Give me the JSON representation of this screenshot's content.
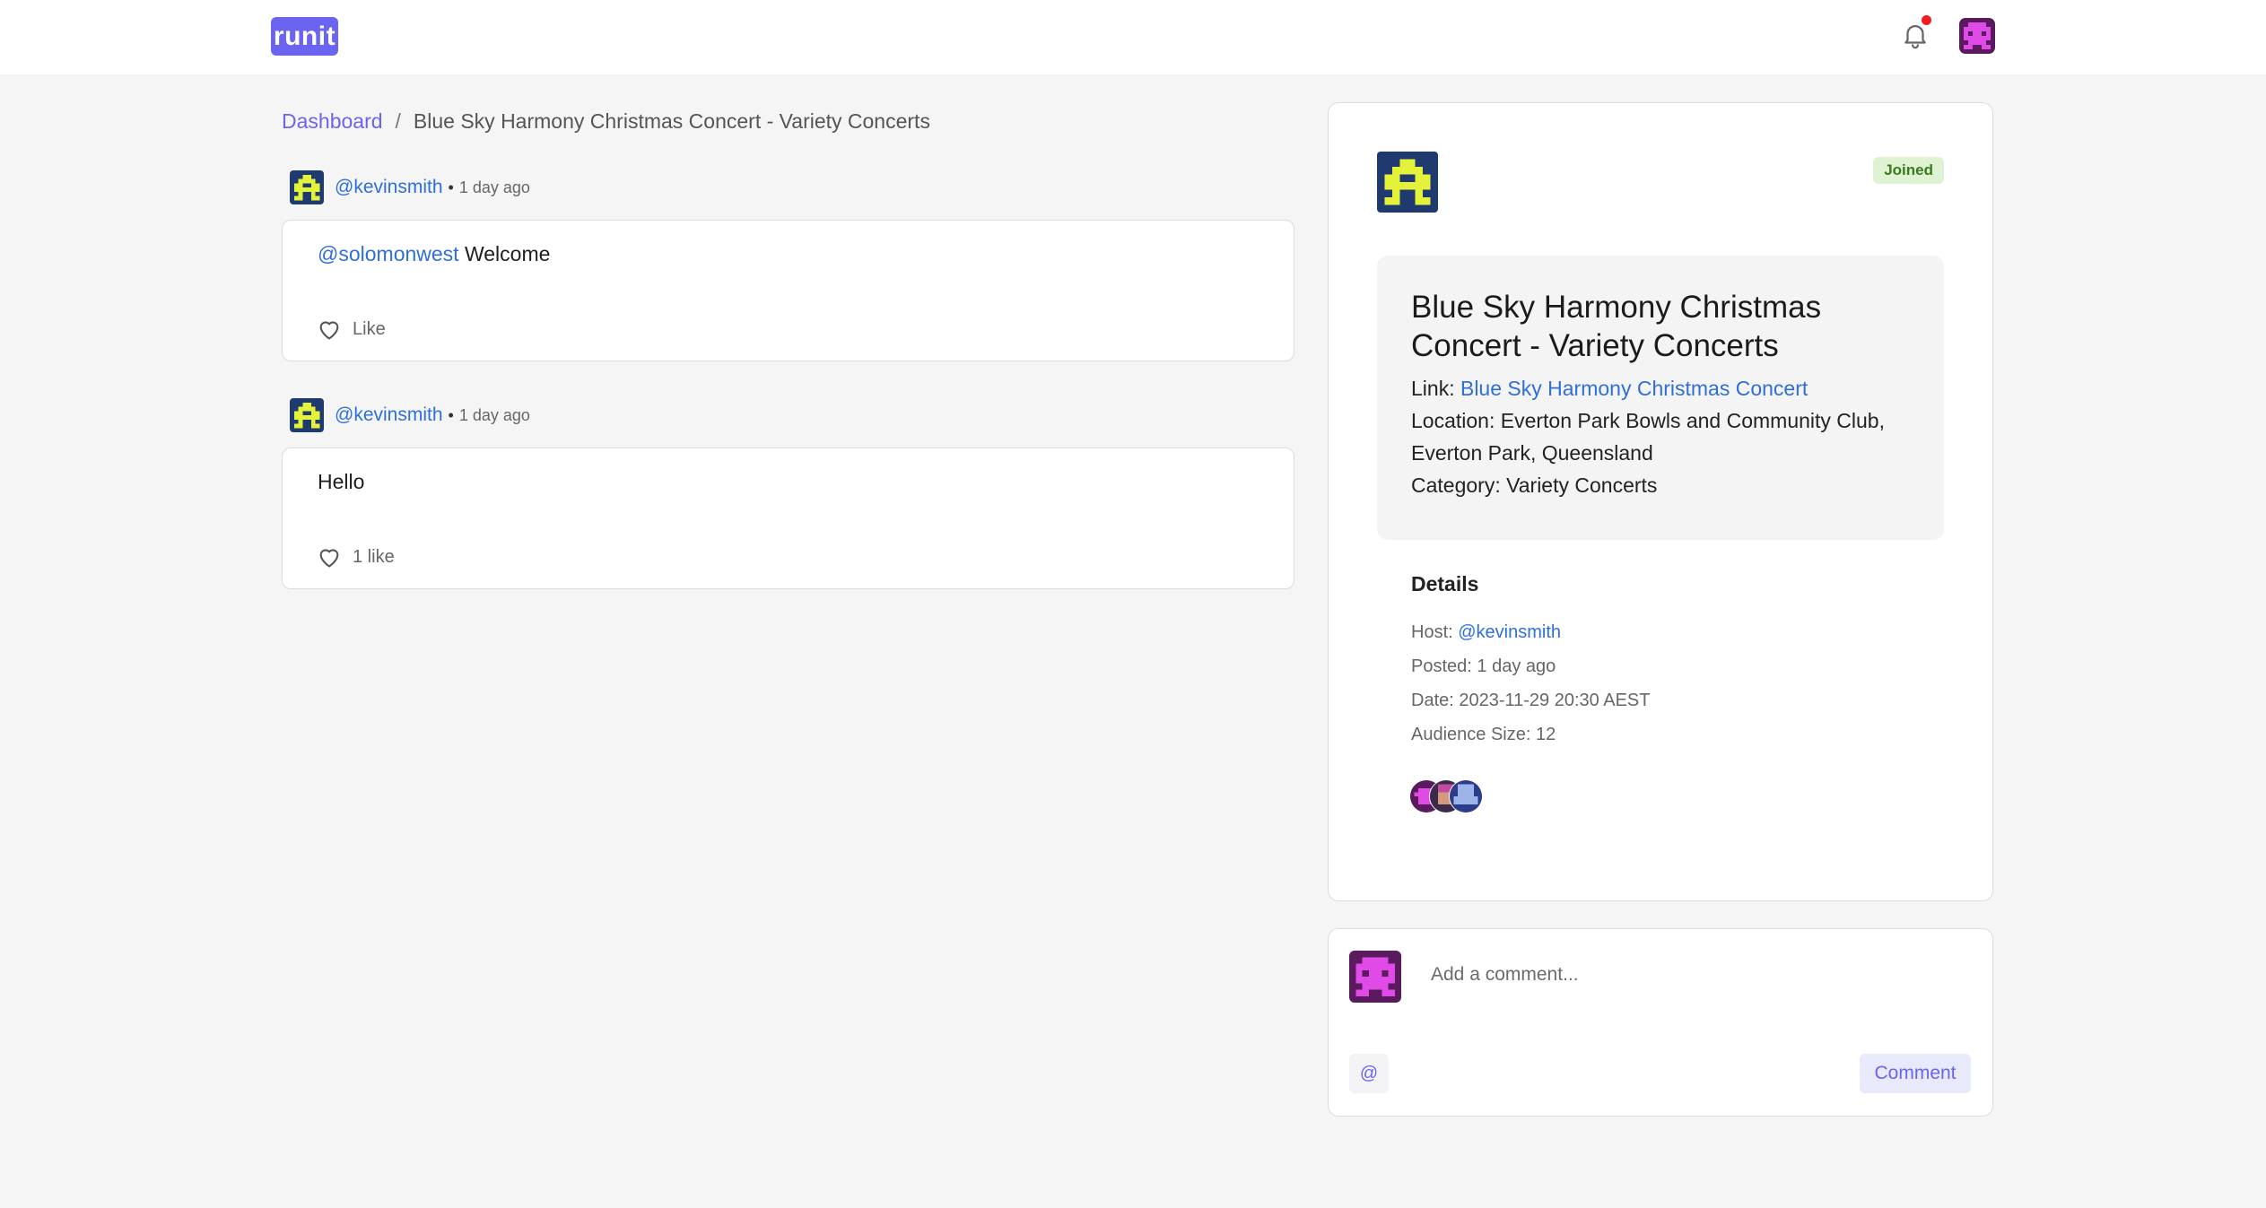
{
  "app": {
    "logo_text": "runit"
  },
  "header": {
    "notifications_icon": "bell-icon",
    "has_unread_notifications": true
  },
  "breadcrumb": {
    "home_label": "Dashboard",
    "separator": "/",
    "current_label": "Blue Sky Harmony Christmas Concert - Variety Concerts"
  },
  "posts": [
    {
      "username": "@kevinsmith",
      "time": "1 day ago",
      "mention": "@solomonwest",
      "text": " Welcome",
      "like_label": "Like"
    },
    {
      "username": "@kevinsmith",
      "time": "1 day ago",
      "mention": "",
      "text": "Hello",
      "like_label": "1 like"
    }
  ],
  "event": {
    "status_badge": "Joined",
    "title": "Blue Sky Harmony Christmas Concert - Variety Concerts",
    "link_label": "Link: ",
    "link_text": "Blue Sky Harmony Christmas Concert",
    "location_label": "Location: ",
    "location": "Everton Park Bowls and Community Club, Everton Park, Queensland",
    "category_label": "Category: ",
    "category": "Variety Concerts",
    "details_title": "Details",
    "host_label": "Host: ",
    "host": "@kevinsmith",
    "posted_label": "Posted: ",
    "posted": "1 day ago",
    "date_label": "Date: ",
    "date": "2023-11-29 20:30 AEST",
    "audience_label": "Audience Size: ",
    "audience_size": "12"
  },
  "comment_box": {
    "placeholder": "Add a comment...",
    "mention_button": "@",
    "submit_label": "Comment"
  },
  "colors": {
    "accent": "#6a64f1",
    "link": "#2f6fdc",
    "notification_dot": "#ef1d1d",
    "joined_bg": "#dff3d2",
    "joined_text": "#3b7a1e"
  }
}
